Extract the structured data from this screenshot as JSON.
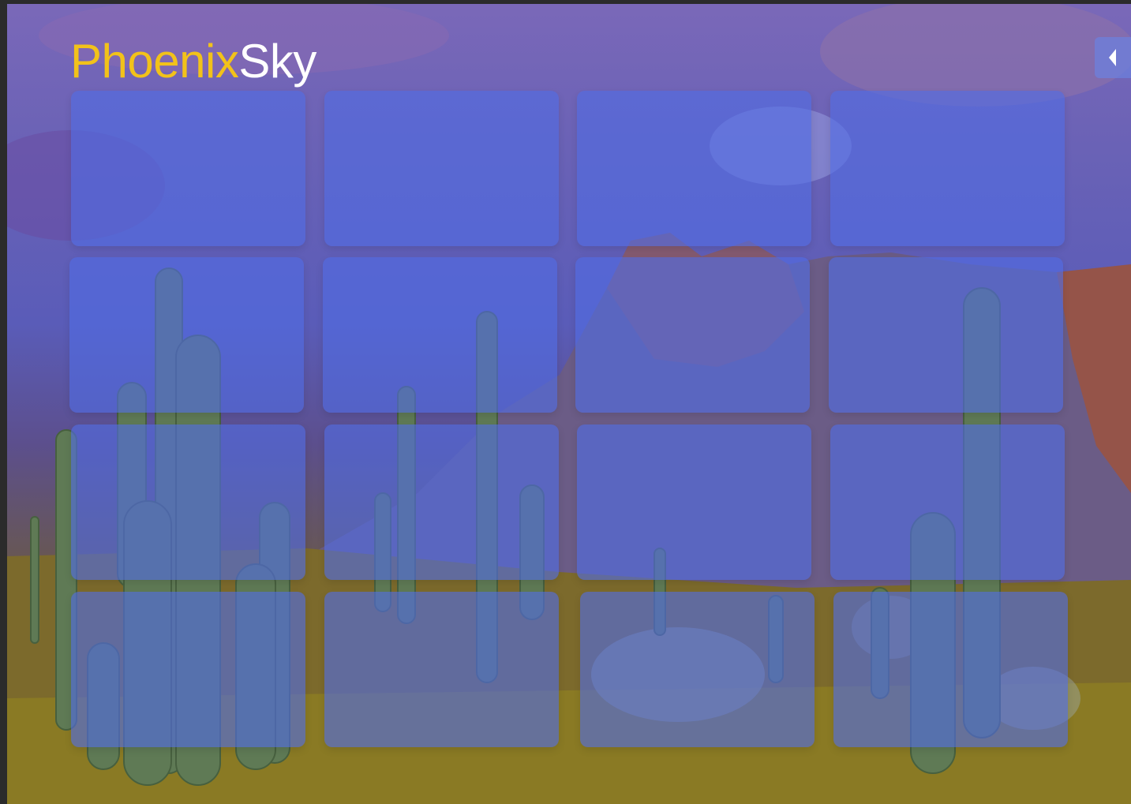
{
  "app": {
    "brand_part_1": "Phoenix",
    "brand_part_2": "Sky",
    "brand_colors": {
      "part_1": "#f2c21a",
      "part_2": "#ffffff"
    }
  },
  "controls": {
    "collapse_icon": "chevron-left-icon"
  },
  "tiles": {
    "count": 16,
    "accent": "#506ce4"
  },
  "background": {
    "subject": "saguaro-cacti-desert-mountain"
  }
}
